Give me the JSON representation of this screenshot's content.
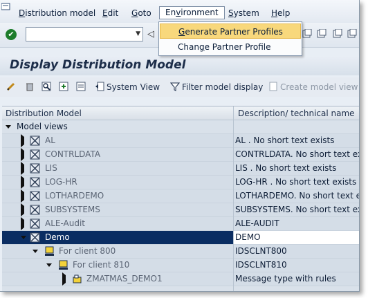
{
  "menubar": {
    "items": [
      {
        "pre": "",
        "u": "D",
        "post": "istribution model"
      },
      {
        "pre": "",
        "u": "E",
        "post": "dit"
      },
      {
        "pre": "",
        "u": "G",
        "post": "oto"
      },
      {
        "pre": "En",
        "u": "v",
        "post": "ironment"
      },
      {
        "pre": "",
        "u": "S",
        "post": "ystem"
      },
      {
        "pre": "",
        "u": "H",
        "post": "elp"
      }
    ]
  },
  "dropdown": {
    "items": [
      {
        "pre": "",
        "u": "G",
        "post": "enerate Partner Profiles"
      },
      {
        "pre": "Chan",
        "u": "g",
        "post": "e Partner Profile"
      }
    ]
  },
  "title": "Display Distribution Model",
  "toolbar": {
    "system_view": "System View",
    "filter": "Filter model display",
    "create": "Create model view"
  },
  "tree": {
    "col1": "Distribution Model",
    "col2": "Description/ technical name",
    "root": "Model views",
    "rows": [
      {
        "label": "AL",
        "desc": "AL        . No short text exists"
      },
      {
        "label": "CONTRLDATA",
        "desc": "CONTRLDATA. No short text exists"
      },
      {
        "label": "LIS",
        "desc": "LIS       . No short text exists"
      },
      {
        "label": "LOG-HR",
        "desc": "LOG-HR    . No short text exists"
      },
      {
        "label": "LOTHARDEMO",
        "desc": "LOTHARDEMO. No short text exists"
      },
      {
        "label": "SUBSYSTEMS",
        "desc": "SUBSYSTEMS. No short text exists"
      },
      {
        "label": "ALE-Audit",
        "desc": "ALE-AUDIT"
      },
      {
        "label": "Demo",
        "desc": "DEMO"
      },
      {
        "label": "For client 800",
        "desc": "IDSCLNT800"
      },
      {
        "label": "For client 810",
        "desc": "IDSCLNT810"
      },
      {
        "label": "ZMATMAS_DEMO1",
        "desc": "Message type with rules"
      }
    ]
  },
  "colors": {
    "selection": "#0a2d62",
    "menu_highlight": "#f8d87c",
    "title_text": "#1c2d49"
  }
}
